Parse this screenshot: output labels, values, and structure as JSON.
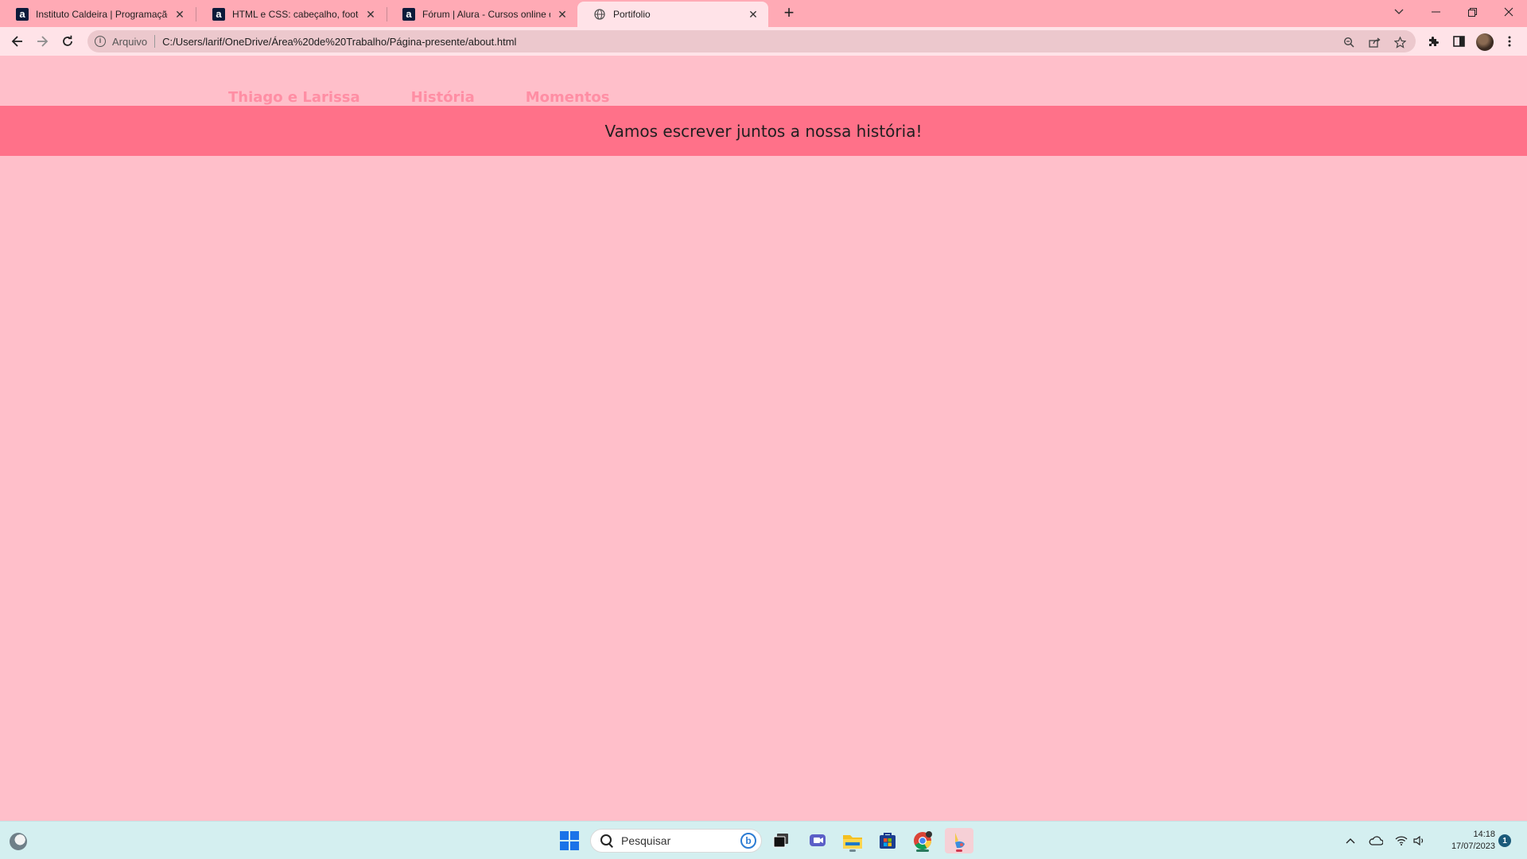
{
  "browser": {
    "tabs": [
      {
        "title": "Instituto Caldeira | Programação",
        "favicon": "alura-icon",
        "active": false
      },
      {
        "title": "HTML e CSS: cabeçalho, footer e",
        "favicon": "alura-icon",
        "active": false
      },
      {
        "title": "Fórum | Alura - Cursos online de",
        "favicon": "alura-icon",
        "active": false
      },
      {
        "title": "Portifolio",
        "favicon": "globe-icon",
        "active": true
      }
    ],
    "address_bar": {
      "scheme_label": "Arquivo",
      "url": "C:/Users/larif/OneDrive/Área%20de%20Trabalho/Página-presente/about.html"
    }
  },
  "page": {
    "nav": [
      "Thiago e Larissa",
      "História",
      "Momentos"
    ],
    "banner_text": "Vamos escrever juntos a nossa história!",
    "colors": {
      "background": "#ffbfca",
      "banner": "#ff7189",
      "nav_text": "#ff8ea4"
    }
  },
  "taskbar": {
    "search_placeholder": "Pesquisar",
    "clock_time": "14:18",
    "clock_date": "17/07/2023",
    "notification_count": "1"
  }
}
